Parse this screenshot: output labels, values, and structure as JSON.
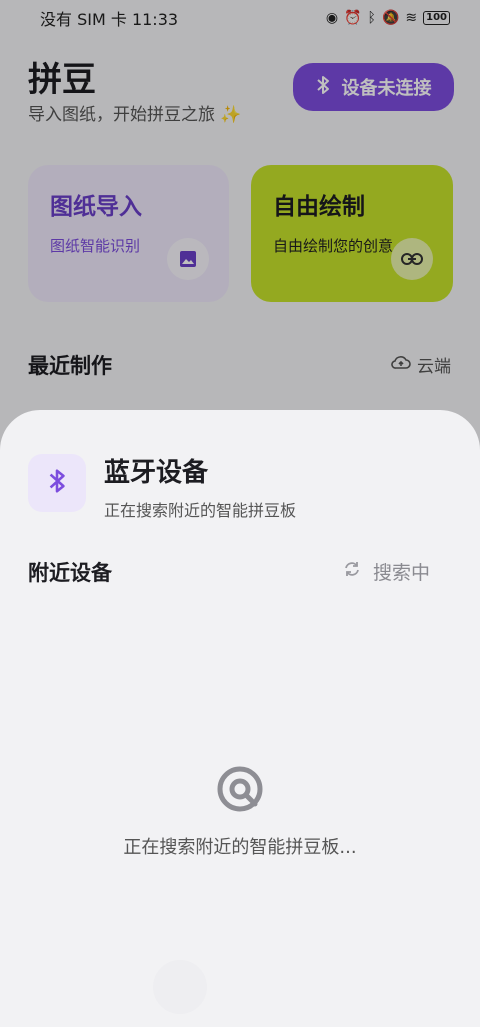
{
  "status_bar": {
    "carrier_time": "没有 SIM 卡 11:33",
    "battery": "100"
  },
  "header": {
    "title": "拼豆",
    "subtitle": "导入图纸，开始拼豆之旅 ✨",
    "device_button": "设备未连接"
  },
  "cards": {
    "import": {
      "title": "图纸导入",
      "desc": "图纸智能识别",
      "icon": "image-icon"
    },
    "draw": {
      "title": "自由绘制",
      "desc": "自由绘制您的创意",
      "icon": "link-icon"
    }
  },
  "recent": {
    "title": "最近制作",
    "cloud": "云端"
  },
  "sheet": {
    "title": "蓝牙设备",
    "subtitle": "正在搜索附近的智能拼豆板",
    "nearby_title": "附近设备",
    "searching_label": "搜索中",
    "searching_text": "正在搜索附近的智能拼豆板..."
  },
  "colors": {
    "accent": "#7c4dde",
    "lime": "#c6e22b"
  }
}
